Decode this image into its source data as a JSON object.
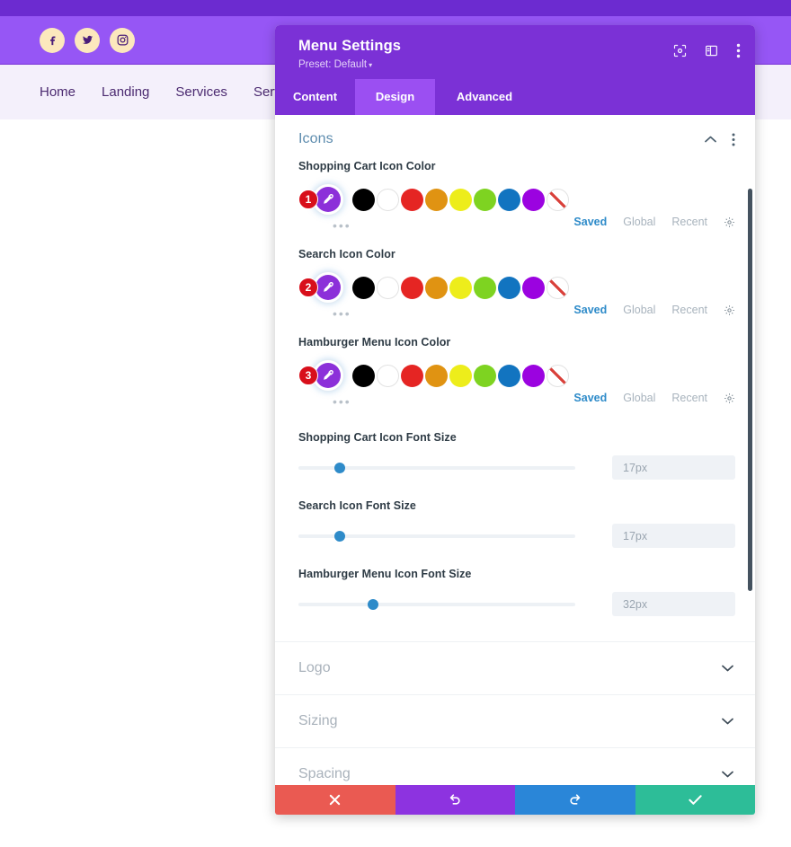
{
  "background_site": {
    "social_icons": [
      {
        "name": "facebook-icon"
      },
      {
        "name": "twitter-icon"
      },
      {
        "name": "instagram-icon"
      }
    ],
    "nav_items": [
      "Home",
      "Landing",
      "Services",
      "Service"
    ],
    "colors": {
      "top_strip": "#6c2bd0",
      "social_bar": "#9656f5",
      "nav_bar": "#f4f0fb",
      "social_btn_bg": "#fce8bd",
      "nav_text": "#4b2a70"
    }
  },
  "modal": {
    "title": "Menu Settings",
    "preset_label": "Preset: Default",
    "preset_caret": "▾",
    "header_icons": [
      {
        "name": "focus-frame-icon"
      },
      {
        "name": "layout-panel-icon"
      },
      {
        "name": "kebab-menu-icon"
      }
    ],
    "tabs": [
      {
        "label": "Content",
        "active": false
      },
      {
        "label": "Design",
        "active": true
      },
      {
        "label": "Advanced",
        "active": false
      }
    ],
    "colors": {
      "header_bg": "#7b31d6",
      "tab_active_bg": "#9b4ff2",
      "section_title": "#5d8cae",
      "accent_blue": "#2e8bc9",
      "badge_red": "#d80f1b",
      "picker_purple": "#8c30d9"
    }
  },
  "icons_section": {
    "title": "Icons",
    "expanded": true,
    "collapse_icon": "chevron-up-icon",
    "menu_icon": "kebab-menu-icon",
    "palette_swatches": [
      {
        "name": "black",
        "hex": "#000000"
      },
      {
        "name": "white",
        "hex": "#ffffff"
      },
      {
        "name": "red",
        "hex": "#e52523"
      },
      {
        "name": "orange",
        "hex": "#e09312"
      },
      {
        "name": "yellow",
        "hex": "#eded1b"
      },
      {
        "name": "green",
        "hex": "#7ed321"
      },
      {
        "name": "blue",
        "hex": "#1274c0"
      },
      {
        "name": "purple",
        "hex": "#9b03e0"
      },
      {
        "name": "transparent",
        "hex": "transparent"
      }
    ],
    "palette_links": [
      {
        "label": "Saved",
        "active": true
      },
      {
        "label": "Global",
        "active": false
      },
      {
        "label": "Recent",
        "active": false
      }
    ],
    "palette_settings_icon": "gear-icon",
    "responsive_dots": "•••",
    "color_fields": [
      {
        "label": "Shopping Cart Icon Color",
        "badge": "1",
        "selected_color": "#8c30d9"
      },
      {
        "label": "Search Icon Color",
        "badge": "2",
        "selected_color": "#8c30d9"
      },
      {
        "label": "Hamburger Menu Icon Color",
        "badge": "3",
        "selected_color": "#8c30d9"
      }
    ],
    "slider_fields": [
      {
        "label": "Shopping Cart Icon Font Size",
        "value": "17px",
        "percent": 15
      },
      {
        "label": "Search Icon Font Size",
        "value": "17px",
        "percent": 15
      },
      {
        "label": "Hamburger Menu Icon Font Size",
        "value": "32px",
        "percent": 27
      }
    ]
  },
  "closed_sections": [
    {
      "label": "Logo",
      "chevron": "chevron-down-icon"
    },
    {
      "label": "Sizing",
      "chevron": "chevron-down-icon"
    },
    {
      "label": "Spacing",
      "chevron": "chevron-down-icon"
    }
  ],
  "footer_buttons": [
    {
      "name": "cancel-button",
      "glyph": "✖",
      "color": "#ea5a52"
    },
    {
      "name": "undo-button",
      "glyph": "↺",
      "color": "#8d33e0"
    },
    {
      "name": "redo-button",
      "glyph": "↻",
      "color": "#2a86d8"
    },
    {
      "name": "save-button",
      "glyph": "✔",
      "color": "#2dbd98"
    }
  ]
}
